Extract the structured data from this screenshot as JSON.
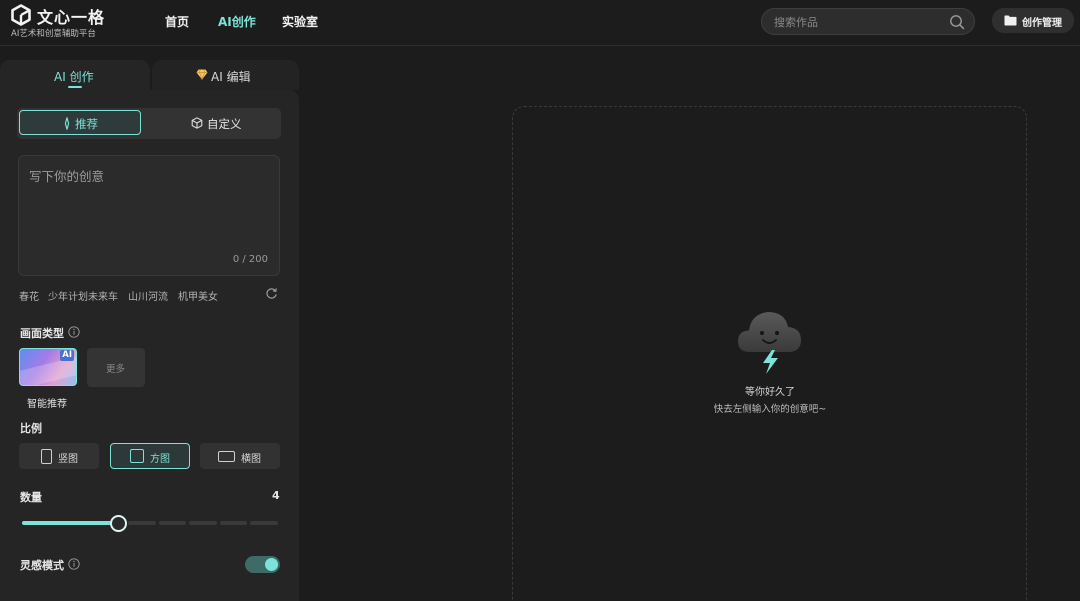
{
  "header": {
    "logo_title": "文心一格",
    "logo_subtitle": "AI艺术和创意辅助平台",
    "nav": [
      {
        "label": "首页"
      },
      {
        "label": "AI创作"
      },
      {
        "label": "实验室"
      }
    ],
    "nav_active": "AI创作",
    "search_placeholder": "搜索作品",
    "manage_label": "创作管理"
  },
  "panel": {
    "tabs": [
      {
        "label": "AI 创作"
      },
      {
        "label": "AI 编辑"
      }
    ],
    "mode": {
      "recommend": "推荐",
      "custom": "自定义",
      "selected": "推荐"
    },
    "prompt": {
      "placeholder": "写下你的创意",
      "value": "",
      "counter": "0 / 200"
    },
    "suggestions": [
      "春花",
      "少年计划未来车",
      "山川河流",
      "机甲美女"
    ],
    "type_section": {
      "title": "画面类型",
      "options": [
        {
          "label": "智能推荐",
          "badge": "AI",
          "selected": true
        },
        {
          "label": "更多"
        }
      ]
    },
    "ratio_section": {
      "title": "比例",
      "options": [
        {
          "label": "竖图"
        },
        {
          "label": "方图"
        },
        {
          "label": "横图"
        }
      ],
      "selected": "方图"
    },
    "count_section": {
      "title": "数量",
      "value": "4",
      "min": 1,
      "max": 8,
      "current": 4
    },
    "inspire": {
      "title": "灵感模式",
      "enabled": true
    }
  },
  "canvas": {
    "empty_title": "等你好久了",
    "empty_subtitle": "快去左侧输入你的创意吧~"
  },
  "colors": {
    "accent": "#7de3d8",
    "background": "#1c1c1c",
    "panel": "#252525"
  }
}
